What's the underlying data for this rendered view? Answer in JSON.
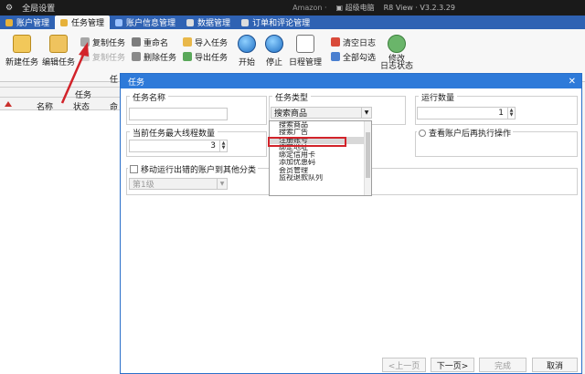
{
  "titlebar": {
    "title": "全局设置",
    "center": "Amazon ·",
    "right1": "▣ 超级电脑",
    "right2": "R8 View · V3.2.3.29"
  },
  "tabs": [
    {
      "label": "账户管理"
    },
    {
      "label": "任务管理"
    },
    {
      "label": "账户信息管理"
    },
    {
      "label": "数据管理"
    },
    {
      "label": "订单和评论管理"
    }
  ],
  "ribbon": {
    "new_task": "新建任务",
    "edit_task": "编辑任务",
    "copy_task": "复制任务",
    "copy_task2": "复制任务",
    "rename": "重命名",
    "delete_task": "删除任务",
    "import_task": "导入任务",
    "export_task": "导出任务",
    "start": "开始",
    "stop": "停止",
    "schedule": "日程管理",
    "clear_log": "清空日志",
    "select_all": "全部勾选",
    "modify_log1": "修改",
    "modify_log2": "日志状态",
    "group_label": "任"
  },
  "grid": {
    "header_task": "任务",
    "col_name": "名称",
    "col_status": "状态",
    "col_cmd": "命令"
  },
  "dialog": {
    "title": "任务",
    "task_name_label": "任务名称",
    "task_type_label": "任务类型",
    "task_type_value": "搜索商品",
    "run_count_label": "运行数量",
    "run_count_value": "1",
    "max_threads_label": "当前任务最大线程数量",
    "max_threads_value": "3",
    "after_run_label": "查看账户后再执行操作",
    "move_label": "移动运行出错的账户到其他分类",
    "move_select": "第1级",
    "list_items": [
      "搜索商品",
      "搜索广告",
      "注册账号",
      "绑定地址",
      "绑定信用卡",
      "添加优惠码",
      "会员管理",
      "监视退款队列"
    ],
    "btn_prev": "<上一页",
    "btn_next": "下一页>",
    "btn_finish": "完成",
    "btn_cancel": "取消"
  },
  "colors": {
    "accent": "#2e7ad9",
    "tabbar": "#2f62b3",
    "highlight": "#d2232a"
  }
}
